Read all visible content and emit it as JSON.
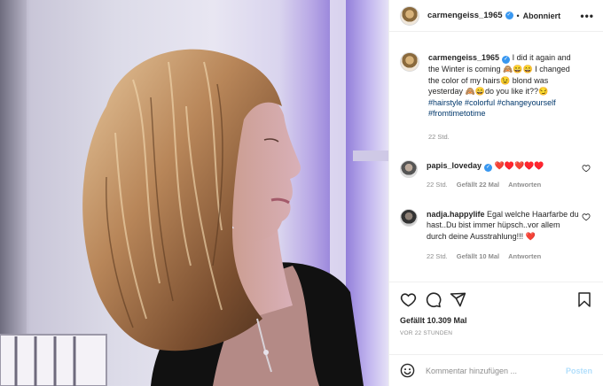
{
  "header": {
    "username": "carmengeiss_1965",
    "follow_label": "Abonniert",
    "more_glyph": "•••"
  },
  "caption": {
    "username": "carmengeiss_1965",
    "text_1": "I did it again and the Winter is coming",
    "emoji_1": "🙈😄😄",
    "text_2": "I changed the color of my hairs",
    "emoji_2": "😉",
    "text_3": "blond was yesterday",
    "emoji_3": "🙈😄",
    "text_4": "do you like it??",
    "emoji_4": "😏",
    "hashtags": [
      "#hairstyle",
      "#colorful",
      "#changeyourself",
      "#fromtimetotime"
    ],
    "time": "22 Std."
  },
  "comments": [
    {
      "username": "papis_loveday",
      "text": "",
      "emoji": "❤️♥️❤️♥️♥️",
      "time": "22 Std.",
      "likes": "Gefällt 22 Mal",
      "reply": "Antworten"
    },
    {
      "username": "nadja.happylife",
      "text": "Egal welche Haarfarbe du hast..Du bist immer hüpsch..vor allem durch deine Ausstrahlung!!!",
      "emoji": "❤️",
      "time": "22 Std.",
      "likes": "Gefällt 10 Mal",
      "reply": "Antworten"
    }
  ],
  "post": {
    "likes": "Gefällt 10.309 Mal",
    "time_ago": "VOR 22 STUNDEN"
  },
  "add_comment": {
    "placeholder": "Kommentar hinzufügen ...",
    "post_label": "Posten"
  },
  "colors": {
    "link": "#00376b",
    "verified": "#3897f0",
    "heart": "#ed4956",
    "post_disabled": "#b2dffc"
  }
}
